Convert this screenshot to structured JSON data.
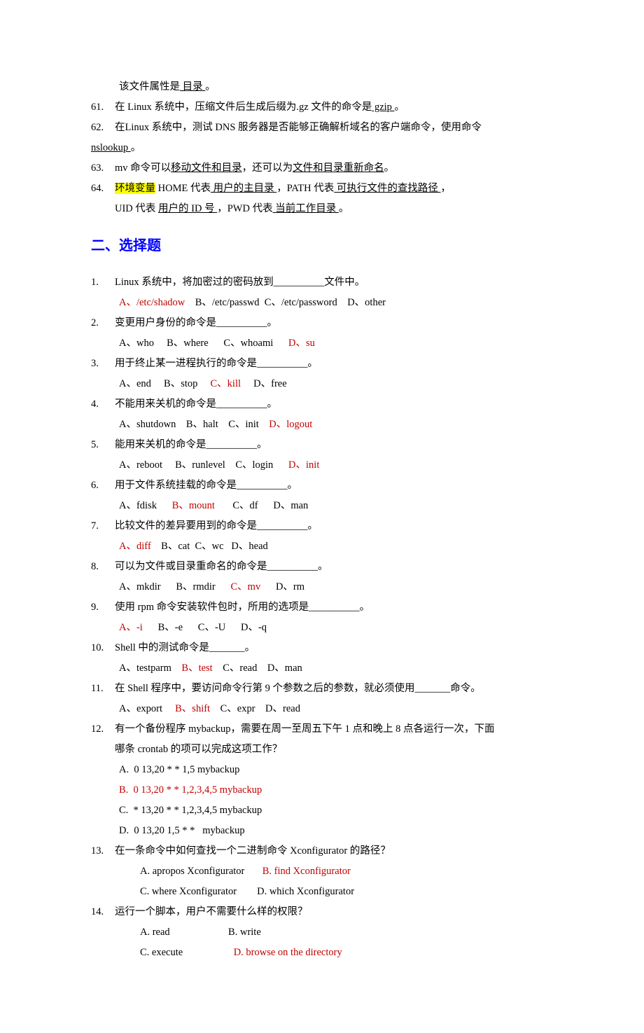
{
  "top": {
    "line60_cont": "该文件属性是",
    "line60_ans": " 目录 ",
    "line60_end": "。",
    "line61_num": "61. ",
    "line61_a": "在 Linux 系统中，压缩文件后生成后缀为.gz 文件的命令是",
    "line61_ans": " gzip ",
    "line61_end": "。",
    "line62_num": "62. ",
    "line62_a": "在Linux 系统中，测试 DNS 服务器是否能够正确解析域名的客户端命令，使用命令",
    "line62_ans": "nslookup ",
    "line62_end": "。",
    "line63_num": "63. ",
    "line63_a": "mv 命令可以",
    "line63_u1": "移动文件和目录",
    "line63_b": "，还可以为",
    "line63_u2": "文件和目录重新命名",
    "line63_c": "。",
    "line64_num": "64. ",
    "line64_hl": "环境变量",
    "line64_a": " HOME 代表",
    "line64_u1": " 用户的主目录 ",
    "line64_b": "，PATH 代表",
    "line64_u2": " 可执行文件的查找路径 ",
    "line64_c": "，",
    "line64_d": "UID 代表 ",
    "line64_u3": "用户的 ID 号 ",
    "line64_e": "，PWD 代表",
    "line64_u4": " 当前工作目录 ",
    "line64_f": "。"
  },
  "section2": "二、选择题",
  "mc": {
    "q1": {
      "num": "1.  ",
      "q": "Linux 系统中，将加密过的密码放到__________文件中。",
      "a": "A、/etc/shadow",
      "b": "    B、/etc/passwd  C、/etc/password    D、other"
    },
    "q2": {
      "num": "2.  ",
      "q": "变更用户身份的命令是__________。",
      "a": "A、who     B、where      C、whoami      ",
      "d": "D、su"
    },
    "q3": {
      "num": "3.  ",
      "q": "用于终止某一进程执行的命令是__________。",
      "a": "A、end     B、stop     ",
      "c": "C、kill",
      "rest": "     D、free"
    },
    "q4": {
      "num": "4.  ",
      "q": "不能用来关机的命令是__________。",
      "a": "A、shutdown    B、halt    C、init    ",
      "d": "D、logout"
    },
    "q5": {
      "num": "5.  ",
      "q": "能用来关机的命令是__________。",
      "a": "A、reboot     B、runlevel    C、login      ",
      "d": "D、init"
    },
    "q6": {
      "num": "6.  ",
      "q": "用于文件系统挂载的命令是__________。",
      "a": "A、fdisk      ",
      "b": "B、mount",
      "rest": "       C、df      D、man"
    },
    "q7": {
      "num": "7.  ",
      "q": "比较文件的差异要用到的命令是__________。",
      "a": "A、diff",
      "rest": "    B、cat  C、wc   D、head"
    },
    "q8": {
      "num": "8.  ",
      "q": "可以为文件或目录重命名的命令是__________。",
      "a": "A、mkdir      B、rmdir      ",
      "c": "C、mv",
      "rest": "      D、rm"
    },
    "q9": {
      "num": "9.  ",
      "q": "使用 rpm 命令安装软件包时，所用的选项是__________。",
      "a": "A、-i",
      "rest": "      B、-e      C、-U      D、-q"
    },
    "q10": {
      "num": "10. ",
      "q": "Shell 中的测试命令是_______。",
      "a": "A、testparm    ",
      "b": "B、test",
      "rest": "    C、read    D、man"
    },
    "q11": {
      "num": "11. ",
      "q": "在 Shell 程序中，要访问命令行第 9 个参数之后的参数，就必须使用_______命令。",
      "a": "A、export     ",
      "b": "B、shift",
      "rest": "    C、expr    D、read"
    },
    "q12": {
      "num": "12. ",
      "q": "有一个备份程序 mybackup，需要在周一至周五下午 1 点和晚上 8 点各运行一次，下面",
      "q2": "哪条 crontab 的项可以完成这项工作？",
      "a": "A.  0 13,20 * * 1,5 mybackup",
      "b": "B.  0 13,20 * * 1,2,3,4,5 mybackup",
      "c": "C.  * 13,20 * * 1,2,3,4,5 mybackup",
      "d": "D.  0 13,20 1,5 * *   mybackup"
    },
    "q13": {
      "num": "13. ",
      "q": "在一条命令中如何查找一个二进制命令 Xconfigurator 的路径？",
      "a": "A. apropos Xconfigurator       ",
      "b": "B. find Xconfigurator",
      "c": "C. where Xconfigurator        D. which Xconfigurator"
    },
    "q14": {
      "num": "14. ",
      "q": "运行一个脚本，用户不需要什么样的权限？",
      "a": "A. read                       B. write",
      "c": "C. execute                    ",
      "d": "D. browse on the directory"
    }
  }
}
